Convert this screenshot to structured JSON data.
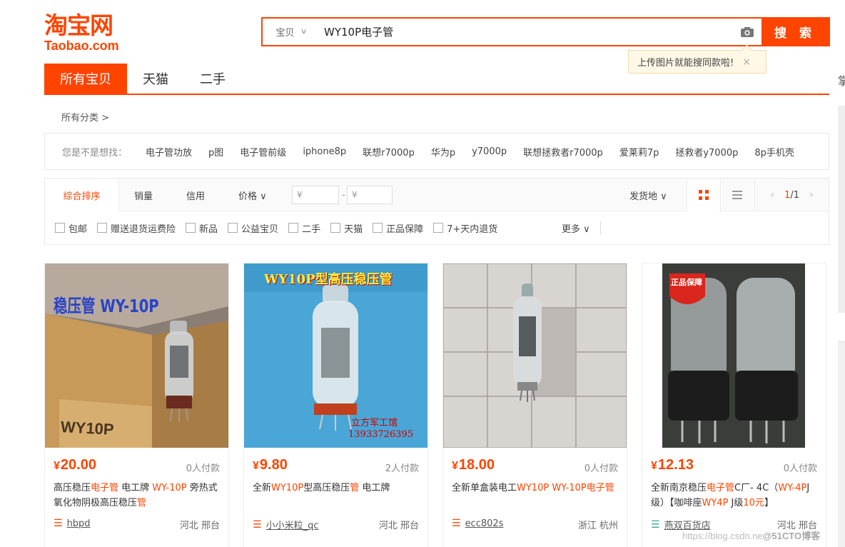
{
  "logo": {
    "cn": "淘宝网",
    "en": "Taobao.com"
  },
  "search": {
    "type_label": "宝贝",
    "query": "WY10P电子管",
    "button_label": "搜 索"
  },
  "tip": {
    "text": "上传图片就能搜同款啦!",
    "close": "×"
  },
  "tabs": [
    "所有宝贝",
    "天猫",
    "二手"
  ],
  "right_edge_char": "掌",
  "breadcrumb": "所有分类 >",
  "suggest": {
    "label": "您是不是想找：",
    "keywords": [
      "电子管功放",
      "p图",
      "电子管前级",
      "iphone8p",
      "联想r7000p",
      "华为p",
      "y7000p",
      "联想拯救者r7000p",
      "爱莱莉7p",
      "拯救者y7000p",
      "8p手机壳"
    ]
  },
  "sort": {
    "items": [
      "综合排序",
      "销量",
      "信用",
      "价格 ∨"
    ],
    "price_from": "¥",
    "price_dash": "-",
    "price_to": "¥",
    "ship_from": "发货地 ∨",
    "page_current": "1",
    "page_total": "/1"
  },
  "filters": [
    "包邮",
    "赠送退货运费险",
    "新品",
    "公益宝贝",
    "二手",
    "天猫",
    "正品保障",
    "7+天内退货"
  ],
  "more": "更多 ∨",
  "products": [
    {
      "price": "20.00",
      "paid": "0人付款",
      "title_parts": [
        "高压稳压",
        "电子管",
        " 电工牌 ",
        "WY-10P",
        " 旁热式氧化物阴极高压稳压",
        "管"
      ],
      "shop": "hbpd",
      "location": "河北 邢台",
      "img_text": "稳压管 WY-10P",
      "box_text": "WY10P"
    },
    {
      "price": "9.80",
      "paid": "2人付款",
      "title_parts": [
        "全新",
        "WY10P",
        "型高压稳压",
        "管",
        " 电工牌",
        ""
      ],
      "shop": "小小米粒_qc",
      "location": "河北 邢台",
      "img_text": "WY10P型高压稳压管",
      "img_text2": "立方军工馆",
      "img_text3": "13933726395"
    },
    {
      "price": "18.00",
      "paid": "0人付款",
      "title_parts": [
        "全新单盒装电工",
        "WY10P WY-10P电子管",
        "",
        "",
        "",
        ""
      ],
      "shop": "ecc802s",
      "location": "浙江 杭州"
    },
    {
      "price": "12.13",
      "paid": "0人付款",
      "title_parts": [
        "全新南京稳压",
        "电子管",
        "C厂- 4C（",
        "WY-4P",
        "J级）【咖啡座",
        "WY4P",
        " J级",
        "10元",
        "】"
      ],
      "shop": "燕双百货店",
      "location": "河北 邢台",
      "badge_text": "正品保障"
    }
  ],
  "watermark": {
    "url": "https://blog.csdn.ne",
    "brand": "@51CTO博客"
  }
}
